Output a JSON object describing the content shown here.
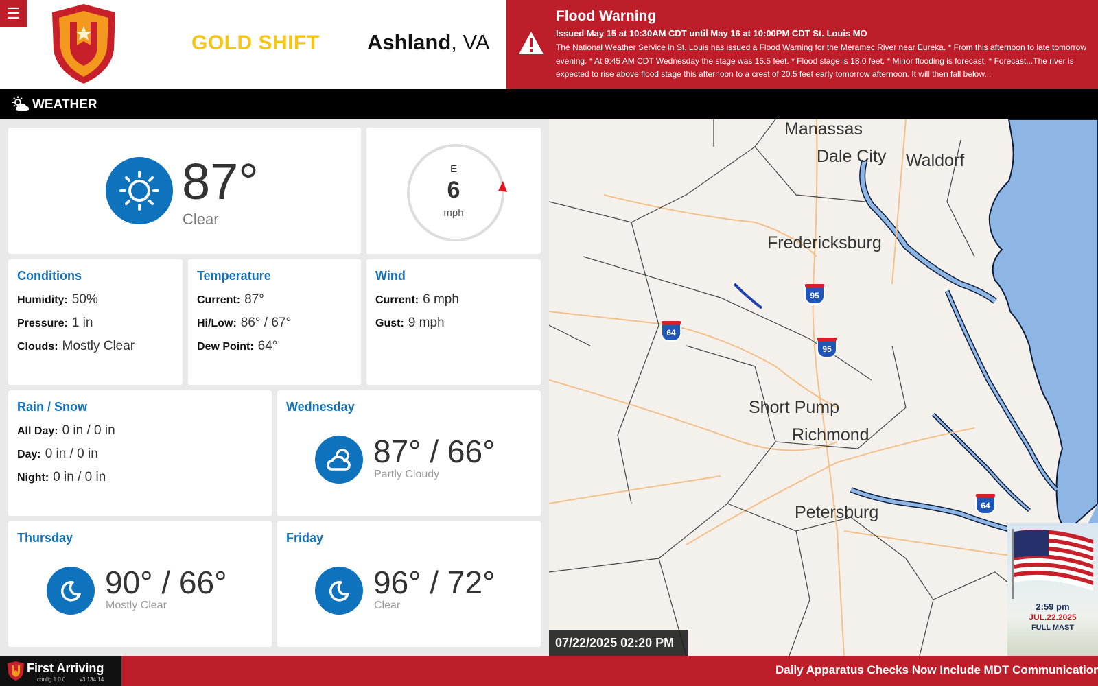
{
  "header": {
    "menu_icon": "hamburger-menu-icon",
    "shift": "GOLD SHIFT",
    "location_city": "Ashland",
    "location_state": ", VA"
  },
  "alert": {
    "title": "Flood Warning",
    "issued": "Issued May 15 at 10:30AM CDT until May 16 at 10:00PM CDT St. Louis MO",
    "body": "The National Weather Service in St. Louis has issued a Flood Warning for the Meramec River near Eureka. * From this afternoon to late tomorrow evening. * At 9:45 AM CDT Wednesday the stage was 15.5 feet. * Flood stage is 18.0 feet. * Minor flooding is forecast. * Forecast...The river is expected to rise above flood stage this afternoon to a crest of 20.5 feet early tomorrow afternoon. It will then fall below...",
    "color": "#bd1e2a"
  },
  "section": {
    "title": "WEATHER",
    "icon": "partly-cloudy-sun-icon"
  },
  "current": {
    "temp": "87°",
    "condition": "Clear",
    "icon": "sun-icon"
  },
  "wind_gauge": {
    "direction": "E",
    "speed": "6",
    "unit": "mph"
  },
  "conditions": {
    "title": "Conditions",
    "humidity_label": "Humidity:",
    "humidity": "50%",
    "pressure_label": "Pressure:",
    "pressure": "1 in",
    "clouds_label": "Clouds:",
    "clouds": "Mostly Clear"
  },
  "temperature": {
    "title": "Temperature",
    "current_label": "Current:",
    "current": "87°",
    "hilow_label": "Hi/Low:",
    "hilow": "86° / 67°",
    "dew_label": "Dew Point:",
    "dew": "64°"
  },
  "wind": {
    "title": "Wind",
    "current_label": "Current:",
    "current": "6 mph",
    "gust_label": "Gust:",
    "gust": "9 mph"
  },
  "rain": {
    "title": "Rain / Snow",
    "allday_label": "All Day:",
    "allday": "0 in / 0 in",
    "day_label": "Day:",
    "day": "0 in / 0 in",
    "night_label": "Night:",
    "night": "0 in / 0 in"
  },
  "forecast": [
    {
      "day": "Wednesday",
      "temps": "87° / 66°",
      "condition": "Partly Cloudy",
      "icon": "partly-cloudy-icon"
    },
    {
      "day": "Thursday",
      "temps": "90° / 66°",
      "condition": "Mostly Clear",
      "icon": "moon-icon"
    },
    {
      "day": "Friday",
      "temps": "96° / 72°",
      "condition": "Clear",
      "icon": "moon-icon"
    }
  ],
  "map": {
    "timestamp": "07/22/2025 02:20 PM",
    "cities": [
      "Manassas",
      "Dale City",
      "Waldorf",
      "Fredericksburg",
      "Short Pump",
      "Richmond",
      "Petersburg"
    ],
    "shields": [
      "95",
      "64",
      "95",
      "64"
    ]
  },
  "flag": {
    "time": "2:59 pm",
    "date": "JUL.22.2025",
    "status": "FULL MAST"
  },
  "footer": {
    "brand": "First Arriving",
    "config": "config 1.0.0",
    "version": "v3.134.14",
    "ticker": "Daily Apparatus Checks Now Include MDT Communications C"
  }
}
